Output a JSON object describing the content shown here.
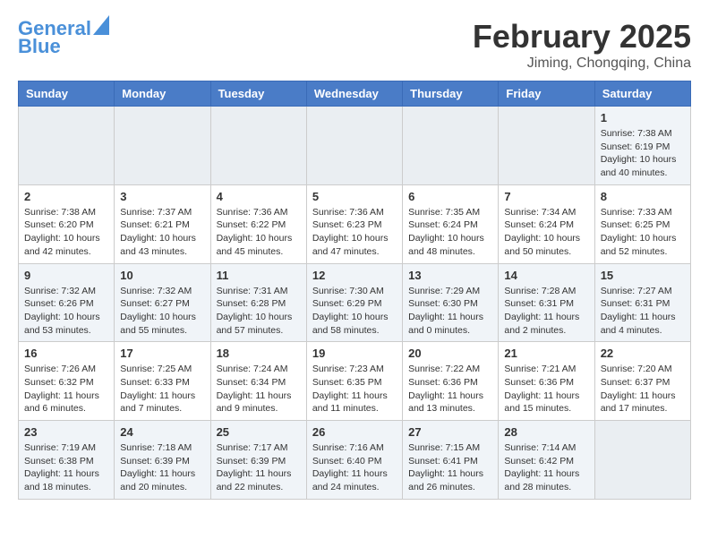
{
  "logo": {
    "line1": "General",
    "line2": "Blue"
  },
  "title": "February 2025",
  "location": "Jiming, Chongqing, China",
  "weekdays": [
    "Sunday",
    "Monday",
    "Tuesday",
    "Wednesday",
    "Thursday",
    "Friday",
    "Saturday"
  ],
  "weeks": [
    [
      {
        "day": "",
        "info": ""
      },
      {
        "day": "",
        "info": ""
      },
      {
        "day": "",
        "info": ""
      },
      {
        "day": "",
        "info": ""
      },
      {
        "day": "",
        "info": ""
      },
      {
        "day": "",
        "info": ""
      },
      {
        "day": "1",
        "info": "Sunrise: 7:38 AM\nSunset: 6:19 PM\nDaylight: 10 hours\nand 40 minutes."
      }
    ],
    [
      {
        "day": "2",
        "info": "Sunrise: 7:38 AM\nSunset: 6:20 PM\nDaylight: 10 hours\nand 42 minutes."
      },
      {
        "day": "3",
        "info": "Sunrise: 7:37 AM\nSunset: 6:21 PM\nDaylight: 10 hours\nand 43 minutes."
      },
      {
        "day": "4",
        "info": "Sunrise: 7:36 AM\nSunset: 6:22 PM\nDaylight: 10 hours\nand 45 minutes."
      },
      {
        "day": "5",
        "info": "Sunrise: 7:36 AM\nSunset: 6:23 PM\nDaylight: 10 hours\nand 47 minutes."
      },
      {
        "day": "6",
        "info": "Sunrise: 7:35 AM\nSunset: 6:24 PM\nDaylight: 10 hours\nand 48 minutes."
      },
      {
        "day": "7",
        "info": "Sunrise: 7:34 AM\nSunset: 6:24 PM\nDaylight: 10 hours\nand 50 minutes."
      },
      {
        "day": "8",
        "info": "Sunrise: 7:33 AM\nSunset: 6:25 PM\nDaylight: 10 hours\nand 52 minutes."
      }
    ],
    [
      {
        "day": "9",
        "info": "Sunrise: 7:32 AM\nSunset: 6:26 PM\nDaylight: 10 hours\nand 53 minutes."
      },
      {
        "day": "10",
        "info": "Sunrise: 7:32 AM\nSunset: 6:27 PM\nDaylight: 10 hours\nand 55 minutes."
      },
      {
        "day": "11",
        "info": "Sunrise: 7:31 AM\nSunset: 6:28 PM\nDaylight: 10 hours\nand 57 minutes."
      },
      {
        "day": "12",
        "info": "Sunrise: 7:30 AM\nSunset: 6:29 PM\nDaylight: 10 hours\nand 58 minutes."
      },
      {
        "day": "13",
        "info": "Sunrise: 7:29 AM\nSunset: 6:30 PM\nDaylight: 11 hours\nand 0 minutes."
      },
      {
        "day": "14",
        "info": "Sunrise: 7:28 AM\nSunset: 6:31 PM\nDaylight: 11 hours\nand 2 minutes."
      },
      {
        "day": "15",
        "info": "Sunrise: 7:27 AM\nSunset: 6:31 PM\nDaylight: 11 hours\nand 4 minutes."
      }
    ],
    [
      {
        "day": "16",
        "info": "Sunrise: 7:26 AM\nSunset: 6:32 PM\nDaylight: 11 hours\nand 6 minutes."
      },
      {
        "day": "17",
        "info": "Sunrise: 7:25 AM\nSunset: 6:33 PM\nDaylight: 11 hours\nand 7 minutes."
      },
      {
        "day": "18",
        "info": "Sunrise: 7:24 AM\nSunset: 6:34 PM\nDaylight: 11 hours\nand 9 minutes."
      },
      {
        "day": "19",
        "info": "Sunrise: 7:23 AM\nSunset: 6:35 PM\nDaylight: 11 hours\nand 11 minutes."
      },
      {
        "day": "20",
        "info": "Sunrise: 7:22 AM\nSunset: 6:36 PM\nDaylight: 11 hours\nand 13 minutes."
      },
      {
        "day": "21",
        "info": "Sunrise: 7:21 AM\nSunset: 6:36 PM\nDaylight: 11 hours\nand 15 minutes."
      },
      {
        "day": "22",
        "info": "Sunrise: 7:20 AM\nSunset: 6:37 PM\nDaylight: 11 hours\nand 17 minutes."
      }
    ],
    [
      {
        "day": "23",
        "info": "Sunrise: 7:19 AM\nSunset: 6:38 PM\nDaylight: 11 hours\nand 18 minutes."
      },
      {
        "day": "24",
        "info": "Sunrise: 7:18 AM\nSunset: 6:39 PM\nDaylight: 11 hours\nand 20 minutes."
      },
      {
        "day": "25",
        "info": "Sunrise: 7:17 AM\nSunset: 6:39 PM\nDaylight: 11 hours\nand 22 minutes."
      },
      {
        "day": "26",
        "info": "Sunrise: 7:16 AM\nSunset: 6:40 PM\nDaylight: 11 hours\nand 24 minutes."
      },
      {
        "day": "27",
        "info": "Sunrise: 7:15 AM\nSunset: 6:41 PM\nDaylight: 11 hours\nand 26 minutes."
      },
      {
        "day": "28",
        "info": "Sunrise: 7:14 AM\nSunset: 6:42 PM\nDaylight: 11 hours\nand 28 minutes."
      },
      {
        "day": "",
        "info": ""
      }
    ]
  ]
}
